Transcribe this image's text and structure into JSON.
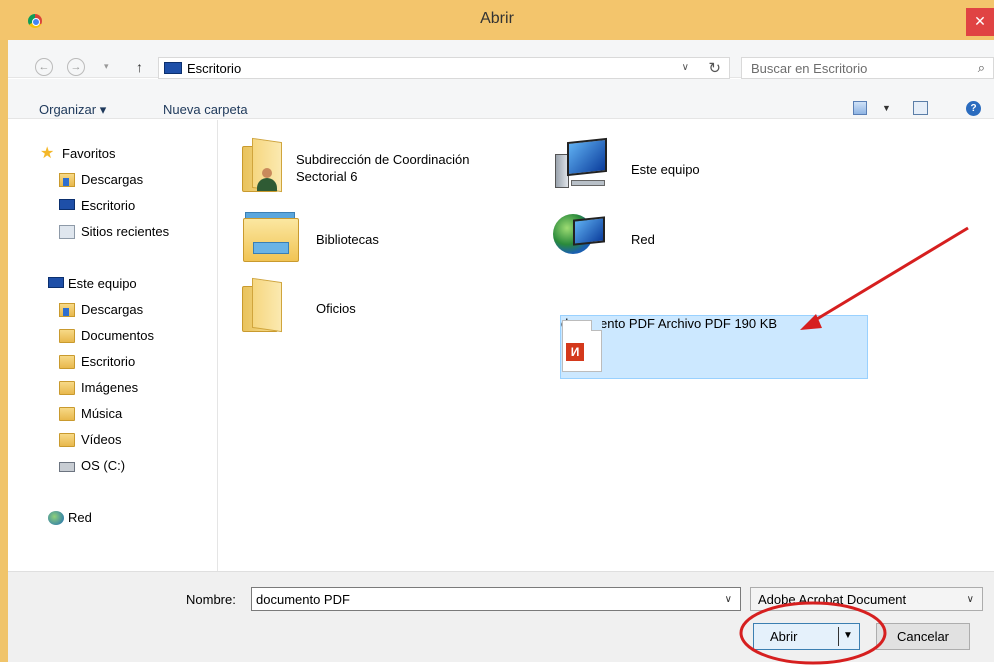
{
  "window": {
    "title": "Abrir",
    "close_glyph": "✕"
  },
  "address": {
    "back_glyph": "←",
    "forward_glyph": "→",
    "recent_glyph": "▾",
    "up_glyph": "↑",
    "path": "Escritorio",
    "dropdown_glyph": "∨",
    "refresh_glyph": "↻",
    "search_placeholder": "Buscar en Escritorio",
    "search_glyph": "⌕"
  },
  "toolbar": {
    "organize_label": "Organizar ▾",
    "new_folder_label": "Nueva carpeta",
    "view_dropdown_glyph": "▼",
    "help_glyph": "?"
  },
  "nav": {
    "favorites": {
      "label": "Favoritos",
      "items": [
        "Descargas",
        "Escritorio",
        "Sitios recientes"
      ]
    },
    "computer": {
      "label": "Este equipo",
      "items": [
        "Descargas",
        "Documentos",
        "Escritorio",
        "Imágenes",
        "Música",
        "Vídeos",
        "OS (C:)"
      ]
    },
    "network": {
      "label": "Red"
    }
  },
  "content": {
    "items": [
      {
        "name_line1": "Subdirección de Coordinación",
        "name_line2": "Sectorial 6",
        "icon": "user-folder-icon"
      },
      {
        "name": "Este equipo",
        "icon": "computer-icon"
      },
      {
        "name": "Bibliotecas",
        "icon": "libraries-icon"
      },
      {
        "name": "Red",
        "icon": "network-icon"
      },
      {
        "name": "Oficios",
        "icon": "folder-icon"
      },
      {
        "name": "documento PDF",
        "type": "Archivo PDF",
        "size": "190 KB",
        "icon": "pdf-file-icon",
        "badge": "И",
        "selected": true
      }
    ]
  },
  "footer": {
    "filename_label": "Nombre:",
    "filename_value": "documento PDF",
    "filetype_value": "Adobe Acrobat Document",
    "dropdown_glyph": "∨",
    "open_label": "Abrir",
    "open_dropdown_glyph": "▼",
    "cancel_label": "Cancelar"
  },
  "annotation": {
    "arrow_color": "#d61f1f",
    "circle_color": "#d61f1f"
  }
}
